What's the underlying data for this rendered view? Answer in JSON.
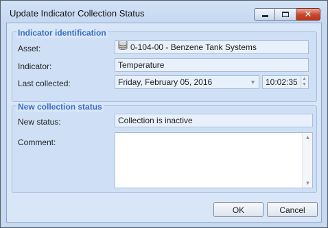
{
  "window": {
    "title": "Update Indicator Collection Status",
    "controls": {
      "minimize": "minimize",
      "maximize": "maximize",
      "close": "✕"
    }
  },
  "identification": {
    "group_title": "Indicator identification",
    "asset_label": "Asset:",
    "asset_value": "0-104-00 - Benzene Tank Systems",
    "asset_icon": "database-icon",
    "indicator_label": "Indicator:",
    "indicator_value": "Temperature",
    "last_collected_label": "Last collected:",
    "last_collected_date": "Friday, February 05, 2016",
    "last_collected_time": "10:02:35"
  },
  "new_status": {
    "group_title": "New collection status",
    "status_label": "New status:",
    "status_value": "Collection is inactive",
    "comment_label": "Comment:",
    "comment_value": ""
  },
  "buttons": {
    "ok": "OK",
    "cancel": "Cancel"
  },
  "colors": {
    "group_title": "#3b6fbe",
    "client_bg": "#d8e6f8",
    "close_button": "#c8452a"
  }
}
